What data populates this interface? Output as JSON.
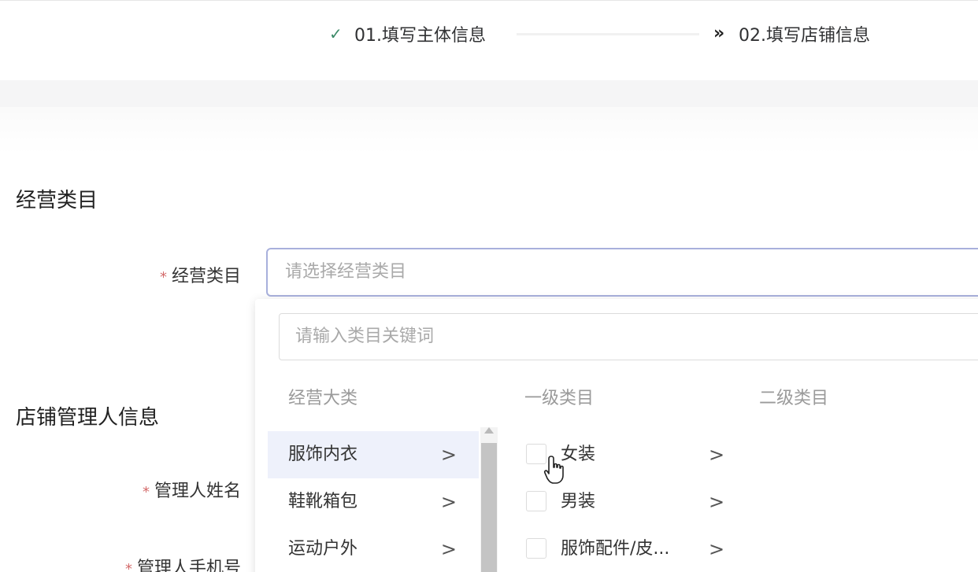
{
  "steps": [
    {
      "icon": "check-icon",
      "glyph": "✓",
      "label": "01.填写主体信息"
    },
    {
      "icon": "double-chevron-right-icon",
      "glyph": "»",
      "label": "02.填写店铺信息"
    }
  ],
  "sections": {
    "business_category": "经营类目",
    "store_manager": "店铺管理人信息"
  },
  "form": {
    "category_label": "经营类目",
    "category_placeholder": "请选择经营类目",
    "manager_name_label": "管理人姓名",
    "manager_phone_label": "管理人手机号",
    "required_mark": "*"
  },
  "dropdown": {
    "search_placeholder": "请输入类目关键词",
    "columns": {
      "major": "经营大类",
      "level1": "一级类目",
      "level2": "二级类目"
    },
    "major_items": [
      {
        "label": "服饰内衣",
        "active": true
      },
      {
        "label": "鞋靴箱包",
        "active": false
      },
      {
        "label": "运动户外",
        "active": false
      }
    ],
    "level1_items": [
      {
        "label": "女装",
        "checked": false
      },
      {
        "label": "男装",
        "checked": false
      },
      {
        "label": "服饰配件/皮...",
        "checked": false
      }
    ],
    "chevron_glyph": ">"
  },
  "colors": {
    "accent_border": "#a8b0dc",
    "active_row": "#eef1fb",
    "required": "#d46b6b",
    "check": "#3c8a68"
  }
}
